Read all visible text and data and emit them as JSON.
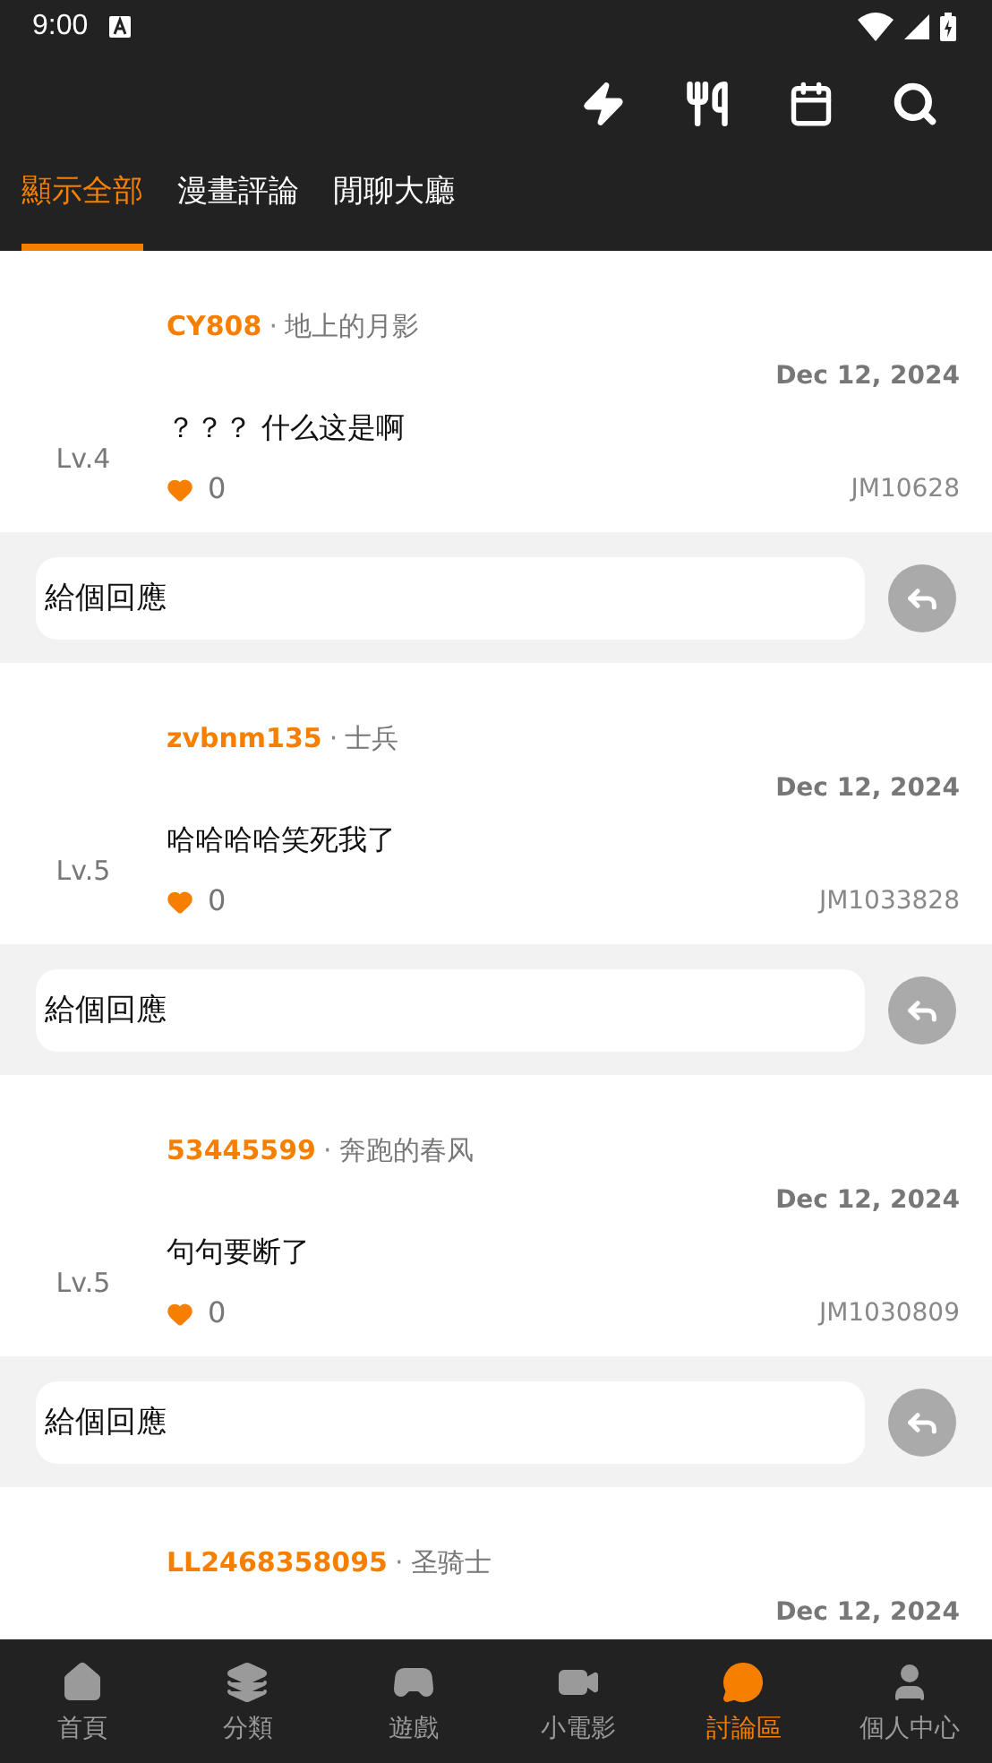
{
  "status_bar": {
    "time": "9:00"
  },
  "tabs": [
    {
      "label": "顯示全部",
      "selected": true
    },
    {
      "label": "漫畫評論",
      "selected": false
    },
    {
      "label": "閒聊大廳",
      "selected": false
    }
  ],
  "posts": [
    {
      "user": "CY808",
      "separator": "·",
      "title": "地上的月影",
      "date": "Dec 12, 2024",
      "text": "？？？ 什么这是啊",
      "level": "Lv.4",
      "likes": "0",
      "ref": "JM10628",
      "reply_placeholder": "給個回應"
    },
    {
      "user": "zvbnm135",
      "separator": "·",
      "title": "士兵",
      "date": "Dec 12, 2024",
      "text": "哈哈哈哈笑死我了",
      "level": "Lv.5",
      "likes": "0",
      "ref": "JM1033828",
      "reply_placeholder": "給個回應"
    },
    {
      "user": "53445599",
      "separator": "·",
      "title": "奔跑的春风",
      "date": "Dec 12, 2024",
      "text": "句句要断了",
      "level": "Lv.5",
      "likes": "0",
      "ref": "JM1030809",
      "reply_placeholder": "給個回應"
    },
    {
      "user": "LL2468358095",
      "separator": "·",
      "title": "圣骑士",
      "date": "Dec 12, 2024"
    }
  ],
  "bottom_nav": [
    {
      "label": "首頁",
      "kind": "home",
      "selected": false
    },
    {
      "label": "分類",
      "kind": "layers",
      "selected": false
    },
    {
      "label": "遊戲",
      "kind": "game",
      "selected": false
    },
    {
      "label": "小電影",
      "kind": "video",
      "selected": false
    },
    {
      "label": "討論區",
      "kind": "chat",
      "selected": true
    },
    {
      "label": "個人中心",
      "kind": "person",
      "selected": false
    }
  ]
}
